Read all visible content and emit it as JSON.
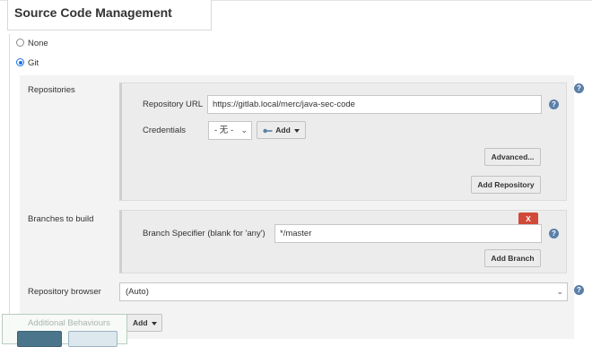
{
  "section": {
    "title": "Source Code Management"
  },
  "scm_options": [
    {
      "label": "None",
      "selected": false
    },
    {
      "label": "Git",
      "selected": true
    }
  ],
  "repositories": {
    "label": "Repositories",
    "url_label": "Repository URL",
    "url_value": "https://gitlab.local/merc/java-sec-code",
    "credentials_label": "Credentials",
    "credentials_selected": "- 无 -",
    "add_label": "Add",
    "advanced_label": "Advanced...",
    "add_repository_label": "Add Repository"
  },
  "branches": {
    "label": "Branches to build",
    "delete_label": "X",
    "specifier_label": "Branch Specifier (blank for 'any')",
    "specifier_value": "*/master",
    "add_branch_label": "Add Branch"
  },
  "repository_browser": {
    "label": "Repository browser",
    "selected": "(Auto)"
  },
  "additional_behaviours": {
    "label": "Additional Behaviours",
    "add_label": "Add"
  },
  "help_icon_glyph": "?",
  "colors": {
    "delete_button": "#d24939",
    "help_icon": "#5a7fa8",
    "radio_checked": "#1a73e8",
    "save_button": "#4b758b"
  }
}
